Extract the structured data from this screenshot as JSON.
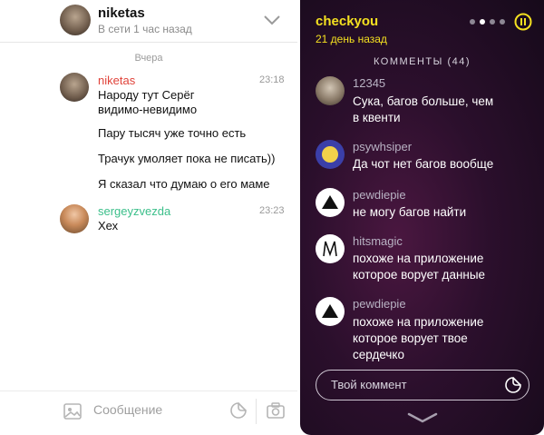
{
  "chat": {
    "header": {
      "name": "niketas",
      "status": "В сети 1 час назад"
    },
    "date_divider": "Вчера",
    "messages": [
      {
        "author": "niketas",
        "time": "23:18",
        "lines": [
          "Народу тут Серёг",
          "видимо-невидимо",
          "Пару тысяч уже точно есть",
          "Трачук умоляет пока не писать))",
          "Я сказал что думаю о его маме"
        ]
      },
      {
        "author": "sergeyzvezda",
        "time": "23:23",
        "lines": [
          "Хех"
        ]
      }
    ],
    "composer": {
      "placeholder": "Сообщение"
    },
    "colors": {
      "niketas": "#e0433a",
      "sergeyzvezda": "#3bbf8a"
    }
  },
  "app": {
    "title": "checkyou",
    "subtitle": "21 день назад",
    "comments_label": "КОММЕНТЫ (44)",
    "comments": [
      {
        "author": "12345",
        "lines": [
          "Сука, багов больше, чем",
          "в квенти"
        ]
      },
      {
        "author": "psywhsiper",
        "lines": [
          "Да чот нет багов вообще"
        ]
      },
      {
        "author": "pewdiepie",
        "lines": [
          "не могу багов найти"
        ]
      },
      {
        "author": "hitsmagic",
        "lines": [
          "похоже на приложение",
          "которое ворует данные"
        ]
      },
      {
        "author": "pewdiepie",
        "lines": [
          "похоже на приложение",
          "которое ворует твое",
          "сердечко"
        ]
      }
    ],
    "comment_input": {
      "placeholder": "Твой коммент"
    },
    "colors": {
      "accent": "#f4e020"
    }
  }
}
